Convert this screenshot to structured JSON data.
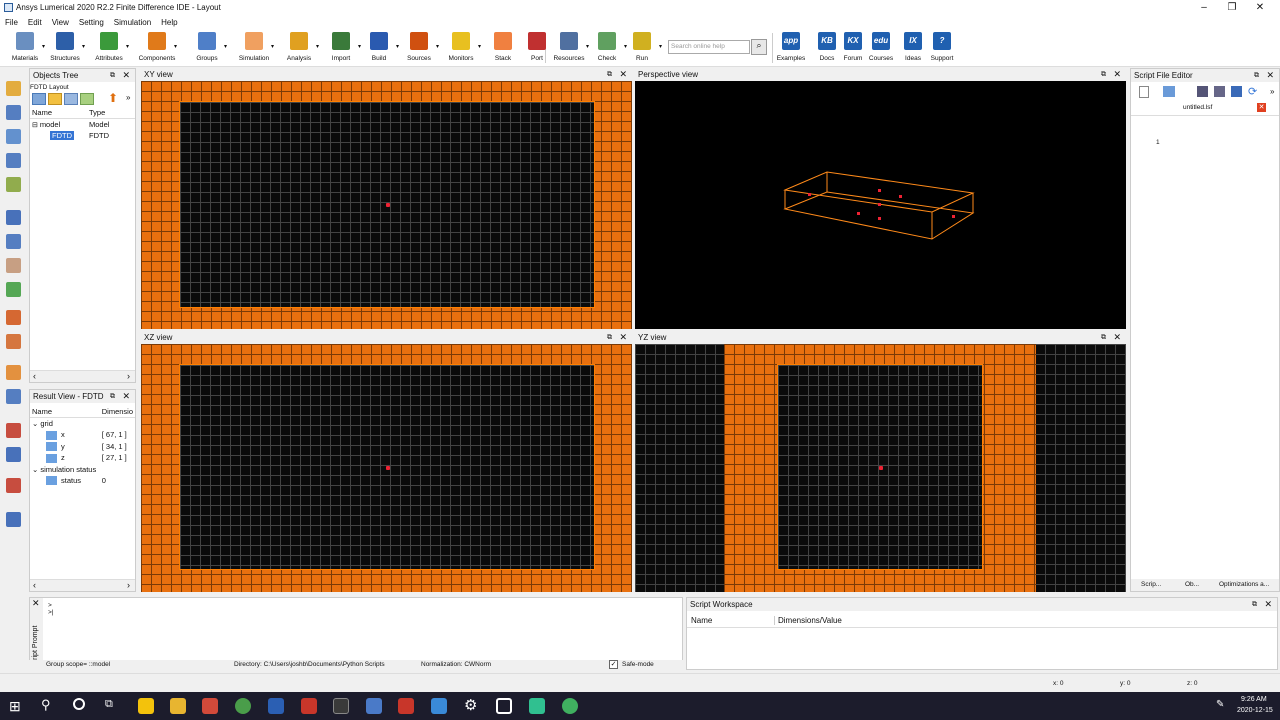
{
  "window": {
    "title": "Ansys Lumerical 2020 R2.2 Finite Difference IDE - Layout",
    "controls": [
      "–",
      "❐",
      "✕"
    ]
  },
  "menu": [
    "File",
    "Edit",
    "View",
    "Setting",
    "Simulation",
    "Help"
  ],
  "toolbar": [
    {
      "label": "Materials",
      "icon": "materials-icon",
      "color": "#6a8fc0"
    },
    {
      "label": "Structures",
      "icon": "structures-icon",
      "color": "#2d5fa8"
    },
    {
      "label": "Attributes",
      "icon": "attributes-icon",
      "color": "#3b9a3b"
    },
    {
      "label": "Components",
      "icon": "components-icon",
      "color": "#e07a1a"
    },
    {
      "label": "Groups",
      "icon": "groups-icon",
      "color": "#4f7fc8"
    },
    {
      "label": "Simulation",
      "icon": "simulation-icon",
      "color": "#f0a060"
    },
    {
      "label": "Analysis",
      "icon": "analysis-icon",
      "color": "#e0a020"
    },
    {
      "label": "Import",
      "icon": "import-icon",
      "color": "#3a7a3a"
    },
    {
      "label": "Build",
      "icon": "build-icon",
      "color": "#2a5ab0"
    },
    {
      "label": "Sources",
      "icon": "sources-icon",
      "color": "#d05010"
    },
    {
      "label": "Monitors",
      "icon": "monitors-icon",
      "color": "#e8c020"
    },
    {
      "label": "Stack",
      "icon": "stack-icon",
      "color": "#f08040"
    },
    {
      "label": "Port",
      "icon": "port-icon",
      "color": "#c03030"
    },
    {
      "label": "Resources",
      "icon": "resources-icon",
      "color": "#5070a0"
    },
    {
      "label": "Check",
      "icon": "check-icon",
      "color": "#60a060"
    },
    {
      "label": "Run",
      "icon": "run-icon",
      "color": "#d0b020"
    },
    {
      "label": "Examples",
      "icon": "app-icon",
      "color": "#2060b0",
      "text": "app"
    },
    {
      "label": "Docs",
      "icon": "kb-icon",
      "color": "#2060b0",
      "text": "KB"
    },
    {
      "label": "Forum",
      "icon": "kx-icon",
      "color": "#2060b0",
      "text": "KX"
    },
    {
      "label": "Courses",
      "icon": "edu-icon",
      "color": "#2060b0",
      "text": "edu"
    },
    {
      "label": "Ideas",
      "icon": "ix-icon",
      "color": "#2060b0",
      "text": "IX"
    },
    {
      "label": "Support",
      "icon": "support-icon",
      "color": "#2060b0",
      "text": "?"
    }
  ],
  "search": {
    "placeholder": "Search online help"
  },
  "objects_tree": {
    "title": "Objects Tree",
    "subtitle": "FDTD Layout",
    "columns": [
      "Name",
      "Type"
    ],
    "rows": [
      {
        "name": "model",
        "type": "Model"
      },
      {
        "name": "FDTD",
        "type": "FDTD"
      }
    ]
  },
  "result_view": {
    "title": "Result View - FDTD",
    "columns": [
      "Name",
      "Dimensio"
    ],
    "groups": [
      {
        "name": "grid",
        "items": [
          {
            "name": "x",
            "value": "[ 67, 1 ]"
          },
          {
            "name": "y",
            "value": "[ 34, 1 ]"
          },
          {
            "name": "z",
            "value": "[ 27, 1 ]"
          }
        ]
      },
      {
        "name": "simulation status",
        "items": [
          {
            "name": "status",
            "value": "0"
          }
        ]
      }
    ]
  },
  "views": {
    "xy": "XY view",
    "perspective": "Perspective view",
    "xz": "XZ view",
    "yz": "YZ view"
  },
  "script_editor": {
    "title": "Script File Editor",
    "tab": "untitled.lsf",
    "line": "1",
    "bottom_tabs": [
      "Scrip...",
      "Ob...",
      "Optimizations a..."
    ]
  },
  "script_prompt": {
    "label": "Script Prompt",
    "lines": [
      ">",
      ">|"
    ]
  },
  "script_workspace": {
    "title": "Script Workspace",
    "columns": [
      "Name",
      "Dimensions/Value"
    ]
  },
  "statusbar": {
    "group_scope": "Group scope= ::model",
    "directory": "Directory: C:\\Users\\joshb\\Documents\\Python Scripts",
    "normalization": "Normalization: CWNorm",
    "safe_mode": "Safe-mode",
    "x": "x: 0",
    "y": "y: 0",
    "z": "z: 0"
  },
  "taskbar": {
    "time": "9:26 AM",
    "date": "2020-12-15"
  }
}
